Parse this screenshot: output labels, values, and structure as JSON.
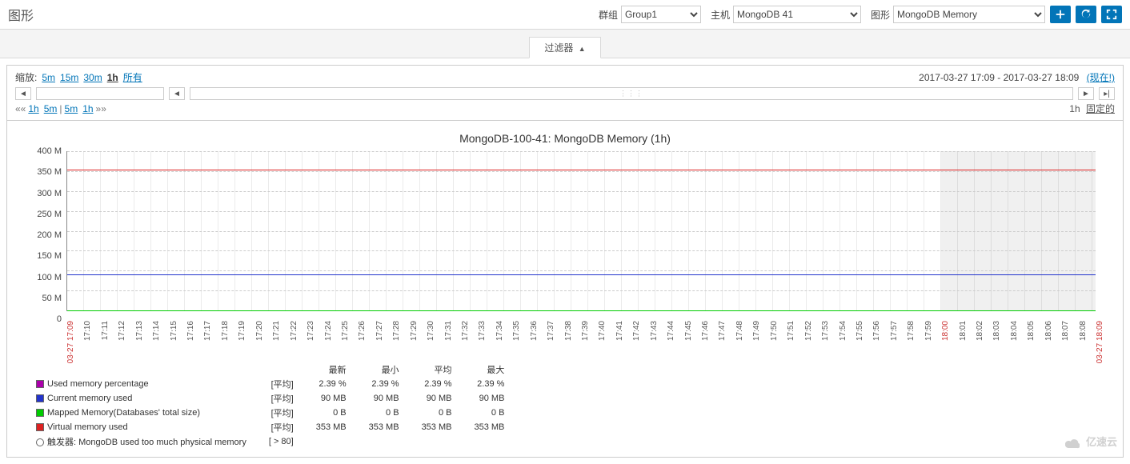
{
  "header": {
    "title": "图形",
    "group_label": "群组",
    "group_value": "Group1",
    "host_label": "主机",
    "host_value": "MongoDB        41",
    "graph_label": "图形",
    "graph_value": "MongoDB Memory"
  },
  "filter_tab": "过滤器",
  "zoom": {
    "label": "缩放:",
    "options": [
      "5m",
      "15m",
      "30m",
      "1h",
      "所有"
    ],
    "selected": "1h",
    "range_text": "2017-03-27 17:09 - 2017-03-27 18:09",
    "now_text": "(现在!)"
  },
  "presets": {
    "left_prefix": "««",
    "left": [
      "1h",
      "5m"
    ],
    "right": [
      "5m",
      "1h"
    ],
    "right_suffix": "»»",
    "sep": "|",
    "fixed_duration": "1h",
    "fixed_label": "固定的"
  },
  "chart_data": {
    "type": "line",
    "title": "MongoDB-100-41: MongoDB Memory (1h)",
    "ylabel": "",
    "ylim": [
      0,
      400
    ],
    "yticks": [
      0,
      "50 M",
      "100 M",
      "150 M",
      "200 M",
      "250 M",
      "300 M",
      "350 M",
      "400 M"
    ],
    "x_start": "03-27 17:09",
    "x_end": "03-27 18:09",
    "x_now": "18:00",
    "xticks": [
      "17:10",
      "17:11",
      "17:12",
      "17:13",
      "17:14",
      "17:15",
      "17:16",
      "17:17",
      "17:18",
      "17:19",
      "17:20",
      "17:21",
      "17:22",
      "17:23",
      "17:24",
      "17:25",
      "17:26",
      "17:27",
      "17:28",
      "17:29",
      "17:30",
      "17:31",
      "17:32",
      "17:33",
      "17:34",
      "17:35",
      "17:36",
      "17:37",
      "17:38",
      "17:39",
      "17:40",
      "17:41",
      "17:42",
      "17:43",
      "17:44",
      "17:45",
      "17:46",
      "17:47",
      "17:48",
      "17:49",
      "17:50",
      "17:51",
      "17:52",
      "17:53",
      "17:54",
      "17:55",
      "17:56",
      "17:57",
      "17:58",
      "17:59",
      "18:00",
      "18:01",
      "18:02",
      "18:03",
      "18:04",
      "18:05",
      "18:06",
      "18:07",
      "18:08"
    ],
    "series": [
      {
        "name": "Used memory percentage",
        "color": "#aa00aa",
        "constant_value": 2.39,
        "unit": "%"
      },
      {
        "name": "Current memory used",
        "color": "#2233cc",
        "constant_value": 90,
        "unit": "MB",
        "y_plot": 90
      },
      {
        "name": "Mapped Memory(Databases' total size)",
        "color": "#00cc00",
        "constant_value": 0,
        "unit": "B",
        "y_plot": 0
      },
      {
        "name": "Virtual memory used",
        "color": "#dd2222",
        "constant_value": 353,
        "unit": "MB",
        "y_plot": 353
      }
    ]
  },
  "legend": {
    "cols": [
      "最新",
      "最小",
      "平均",
      "最大"
    ],
    "agg_label": "[平均]",
    "rows": [
      {
        "color": "#aa00aa",
        "name": "Used memory percentage",
        "latest": "2.39 %",
        "min": "2.39 %",
        "avg": "2.39 %",
        "max": "2.39 %"
      },
      {
        "color": "#2233cc",
        "name": "Current memory used",
        "latest": "90 MB",
        "min": "90 MB",
        "avg": "90 MB",
        "max": "90 MB"
      },
      {
        "color": "#00cc00",
        "name": "Mapped Memory(Databases' total size)",
        "latest": "0 B",
        "min": "0 B",
        "avg": "0 B",
        "max": "0 B"
      },
      {
        "color": "#dd2222",
        "name": "Virtual memory used",
        "latest": "353 MB",
        "min": "353 MB",
        "avg": "353 MB",
        "max": "353 MB"
      }
    ],
    "trigger": {
      "name": "触发器: MongoDB used too much physical memory",
      "cond": "[ > 80]"
    }
  },
  "watermark": "亿速云"
}
